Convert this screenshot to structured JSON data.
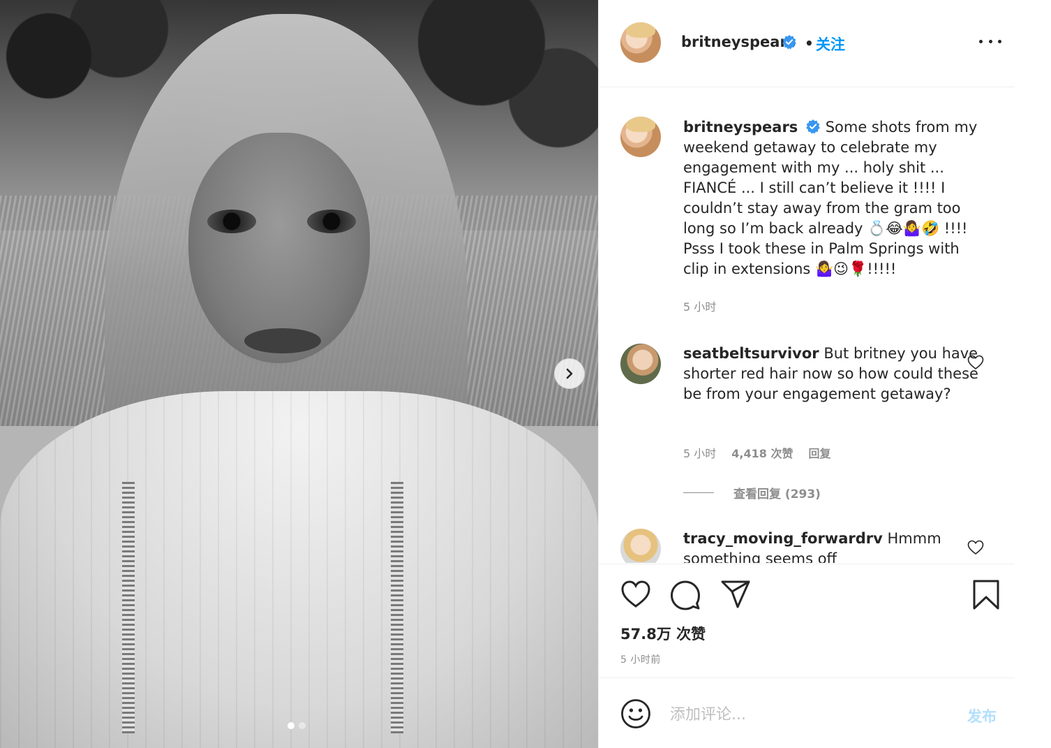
{
  "post": {
    "username": "britneyspears",
    "follow_label": "关注",
    "separator": "•",
    "caption": "Some shots from my weekend getaway to celebrate my engagement with my ... holy shit ... FIANCÉ ... I still can’t believe it !!!! I couldn’t stay away from the gram too long so I’m back already 💍😂🤷‍♀️🤣 !!!! Psss I took these in Palm Springs with clip in extensions 🤷‍♀️😉🌹!!!!!",
    "caption_time": "5 小时",
    "likes": "57.8万 次赞",
    "posted_ago": "5 小时前",
    "carousel": {
      "total": 2,
      "active": 1
    }
  },
  "comments": [
    {
      "username": "seatbeltsurvivor",
      "text": "But britney you have shorter red hair now so how could these be from your engagement getaway?",
      "time": "5 小时",
      "likes": "4,418 次赞",
      "reply_label": "回复",
      "view_replies": "查看回复 (293)"
    },
    {
      "username": "tracy_moving_forwardrv",
      "text": "Hmmm something seems off"
    }
  ],
  "composer": {
    "placeholder": "添加评论...",
    "post_label": "发布"
  },
  "icons": {
    "more": "more-options-icon",
    "verified": "verified-badge-icon",
    "like": "heart-icon",
    "comment": "comment-bubble-icon",
    "share": "paper-plane-icon",
    "save": "bookmark-icon",
    "emoji": "emoji-smiley-icon",
    "next": "chevron-right-icon"
  },
  "colors": {
    "accent": "#0095f6",
    "verified": "#3897f0",
    "muted": "#8e8e8e",
    "text": "#262626",
    "post_disabled": "#b2dffc"
  }
}
